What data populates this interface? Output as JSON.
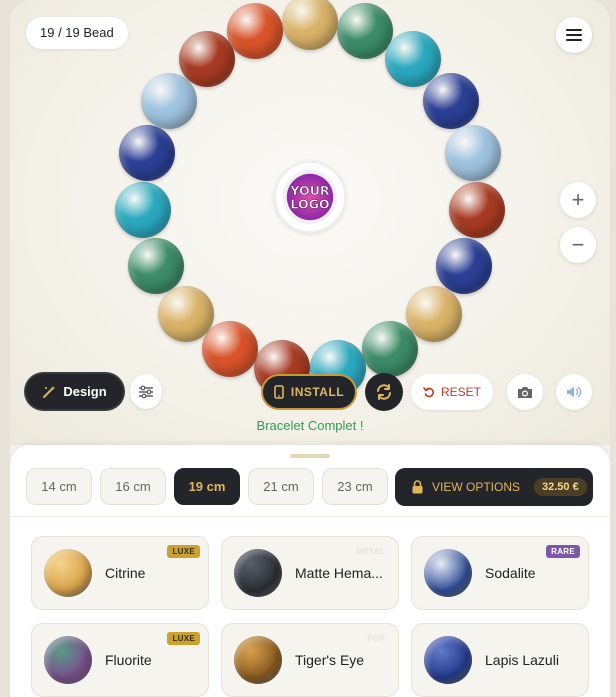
{
  "header": {
    "bead_count": "19 / 19 Bead"
  },
  "logo": {
    "line1": "YOUR",
    "line2": "LOGO"
  },
  "bracelet": {
    "beads": [
      {
        "stone": "Citrine",
        "color": "#d9b267"
      },
      {
        "stone": "Green Jade",
        "color": "#3c8c68"
      },
      {
        "stone": "Turquoise",
        "color": "#2aa8bf"
      },
      {
        "stone": "Lapis Lazuli",
        "color": "#2b3f95"
      },
      {
        "stone": "Aquamarine",
        "color": "#9ec2df"
      },
      {
        "stone": "Red Jasper",
        "color": "#a73a22"
      },
      {
        "stone": "Lapis Lazuli",
        "color": "#2b3f95"
      },
      {
        "stone": "Citrine",
        "color": "#d9b267"
      },
      {
        "stone": "Green Jade",
        "color": "#3c8c68"
      },
      {
        "stone": "Turquoise",
        "color": "#2aa8bf"
      },
      {
        "stone": "Red Jasper",
        "color": "#a73a22"
      },
      {
        "stone": "Carnelian",
        "color": "#d9532a"
      },
      {
        "stone": "Citrine",
        "color": "#d9b267"
      },
      {
        "stone": "Green Jade",
        "color": "#3c8c68"
      },
      {
        "stone": "Turquoise",
        "color": "#2aa8bf"
      },
      {
        "stone": "Lapis Lazuli",
        "color": "#2b3f95"
      },
      {
        "stone": "Aquamarine",
        "color": "#9ec2df"
      },
      {
        "stone": "Red Jasper",
        "color": "#a73a22"
      },
      {
        "stone": "Carnelian",
        "color": "#d9532a"
      }
    ]
  },
  "toolbar": {
    "design_label": "Design",
    "install_label": "INSTALL",
    "reset_label": "RESET",
    "status": "Bracelet Complet !"
  },
  "sizes": [
    {
      "label": "14 cm",
      "active": false
    },
    {
      "label": "16 cm",
      "active": false
    },
    {
      "label": "19 cm",
      "active": true
    },
    {
      "label": "21 cm",
      "active": false
    },
    {
      "label": "23 cm",
      "active": false
    }
  ],
  "view_options": {
    "label": "VIEW OPTIONS",
    "price": "32.50 €"
  },
  "stones": [
    {
      "name": "Citrine",
      "badge": "LUXE",
      "badge_style": "luxe",
      "color": "#d9a24a",
      "highlight": "#f4d58a"
    },
    {
      "name": "Matte Hema...",
      "badge": "METAL",
      "badge_style": "faint",
      "color": "#2a2f35",
      "highlight": "#56606a"
    },
    {
      "name": "Sodalite",
      "badge": "RARE",
      "badge_style": "rare",
      "color": "#2f4d98",
      "highlight": "#e8ecf4"
    },
    {
      "name": "Fluorite",
      "badge": "LUXE",
      "badge_style": "luxe",
      "color": "#7a4f8f",
      "highlight": "#5a9c87"
    },
    {
      "name": "Tiger's Eye",
      "badge": "POP",
      "badge_style": "faint",
      "color": "#8a5a1f",
      "highlight": "#d7a14c"
    },
    {
      "name": "Lapis Lazuli",
      "badge": "",
      "badge_style": "",
      "color": "#233a8c",
      "highlight": "#6379c9"
    }
  ]
}
